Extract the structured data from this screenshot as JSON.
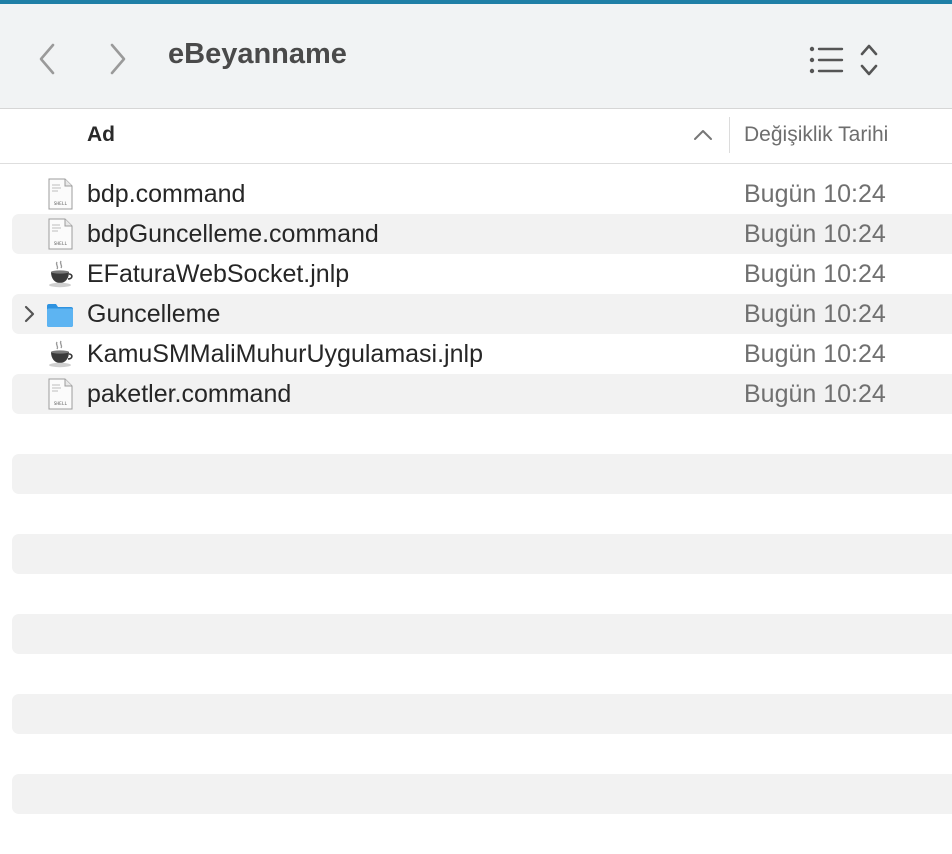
{
  "window": {
    "title": "eBeyanname"
  },
  "toolbar": {
    "back_icon": "chevron-left-icon",
    "forward_icon": "chevron-right-icon",
    "view_icon": "list-view-icon",
    "sort_toggle_icon": "up-down-chevron-icon"
  },
  "columns": {
    "name": "Ad",
    "date": "Değişiklik Tarihi",
    "sort": "ascending"
  },
  "files": [
    {
      "name": "bdp.command",
      "date": "Bugün 10:24",
      "icon": "shell-script-icon"
    },
    {
      "name": "bdpGuncelleme.command",
      "date": "Bugün 10:24",
      "icon": "shell-script-icon"
    },
    {
      "name": "EFaturaWebSocket.jnlp",
      "date": "Bugün 10:24",
      "icon": "java-coffee-icon"
    },
    {
      "name": "Guncelleme",
      "date": "Bugün 10:24",
      "icon": "folder-icon"
    },
    {
      "name": "KamuSMMaliMuhurUygulamasi.jnlp",
      "date": "Bugün 10:24",
      "icon": "java-coffee-icon"
    },
    {
      "name": "paketler.command",
      "date": "Bugün 10:24",
      "icon": "shell-script-icon"
    }
  ],
  "icon_labels": {
    "shell": "SHELL"
  },
  "colors": {
    "accent": "#1f7fa6",
    "folder": "#4aa8ea",
    "toolbar_bg": "#f1f3f4",
    "stripe": "#f2f2f2"
  }
}
